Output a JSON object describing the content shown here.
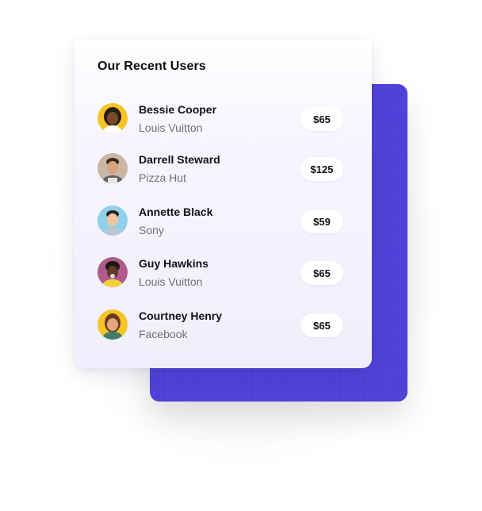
{
  "card": {
    "title": "Our Recent Users"
  },
  "users": [
    {
      "name": "Bessie Cooper",
      "company": "Louis Vuitton",
      "amount": "$65",
      "avatar_icon": "avatar-woman-yellow-bg",
      "avatar_bg": "#f6c525"
    },
    {
      "name": "Darrell Steward",
      "company": "Pizza Hut",
      "amount": "$125",
      "avatar_icon": "avatar-man-beige-bg",
      "avatar_bg": "#c9b6a4"
    },
    {
      "name": "Annette Black",
      "company": "Sony",
      "amount": "$59",
      "avatar_icon": "avatar-man-lightblue-bg",
      "avatar_bg": "#8fd0ea"
    },
    {
      "name": "Guy Hawkins",
      "company": "Louis Vuitton",
      "amount": "$65",
      "avatar_icon": "avatar-man-purple-bg",
      "avatar_bg": "#b05a8c"
    },
    {
      "name": "Courtney Henry",
      "company": "Facebook",
      "amount": "$65",
      "avatar_icon": "avatar-woman-yellow-bg",
      "avatar_bg": "#f6c525"
    }
  ],
  "colors": {
    "accent_purple": "#4b3fd6",
    "card_tint": "#efeefc",
    "pill_bg": "#ffffff",
    "text_primary": "#111118",
    "text_secondary": "#6f6f78"
  }
}
